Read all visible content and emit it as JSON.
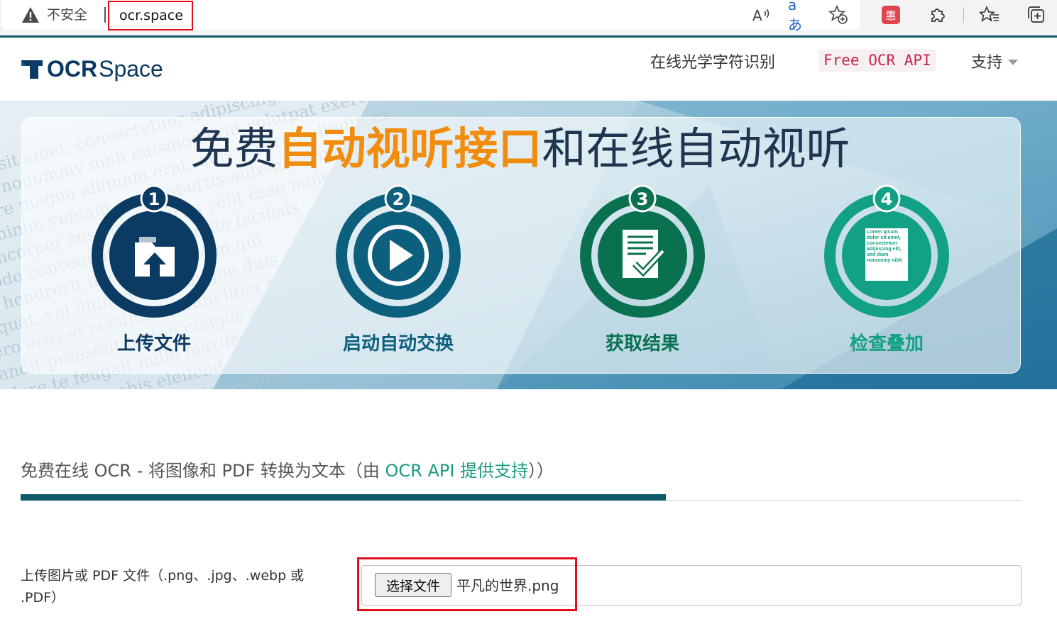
{
  "browser": {
    "insecure_label": "不安全",
    "url": "ocr.space",
    "icons": [
      "read-aloud-icon",
      "translate-icon",
      "add-favorite-icon",
      "extension-red-icon",
      "extensions-icon",
      "favorites-icon",
      "collections-icon"
    ],
    "translate_glyph": "aあ",
    "extension_glyph": "惠"
  },
  "site": {
    "logo_bold": "OCR",
    "logo_light": "Space",
    "nav": {
      "online_ocr": "在线光学字符识别",
      "api": "Free OCR API",
      "support": "支持"
    }
  },
  "hero": {
    "title_pre": "免费",
    "title_highlight": "自动视听接口",
    "title_post": "和在线自动视听",
    "steps": [
      {
        "num": "1",
        "label": "上传文件",
        "color": "#0b3a63"
      },
      {
        "num": "2",
        "label": "启动自动交换",
        "color": "#0d5f7e"
      },
      {
        "num": "3",
        "label": "获取结果",
        "color": "#0a7150"
      },
      {
        "num": "4",
        "label": "检查叠加",
        "color": "#12a184"
      }
    ],
    "doc_text": "Lorem ipsum dolor sit amet, consectetuer adipiscing elit, sed diam nonummy nibh",
    "bg_text": "dolor sit amet, consectetuer adipiscing elit, sed diam nonummy nibh euismod tincidunt ut laoreet dolore magna aliquam erat volutpat. Ut wisi enim ad minim veniam, quis nostrud exerci tation ullamcorper suscipit lobortis nisl ut aliquip ex ea commodo consequat. Duis autem vel eum iriure dolor in hendrerit in vulputate velit esse molestie consequat, vel illum dolore eu feugiat nulla facilisis at vero eros et accumsan et iusto odio dignissim qui blandit praesent luptatum zzril delenit augue duis dolore te feugait nulla facilisi. Nam liber tempor cum soluta nobis eleifend option congue nihil imperdiet doming id quod mazim placerat facer possim assum."
  },
  "content": {
    "headline_pre": "免费在线 OCR - 将图像和 PDF 转换为文本（由 ",
    "headline_link": "OCR API 提供支持",
    "headline_post": "））",
    "progress": 0.645,
    "upload_label": "上传图片或 PDF 文件（.png、.jpg、.webp 或 .PDF）",
    "file_button": "选择文件",
    "file_name": "平凡的世界.png"
  },
  "colors": {
    "accent_teal": "#0f5b6b",
    "highlight_orange": "#f28c0f",
    "annotation_red": "#e0111b",
    "link_green": "#1a9b7f"
  }
}
